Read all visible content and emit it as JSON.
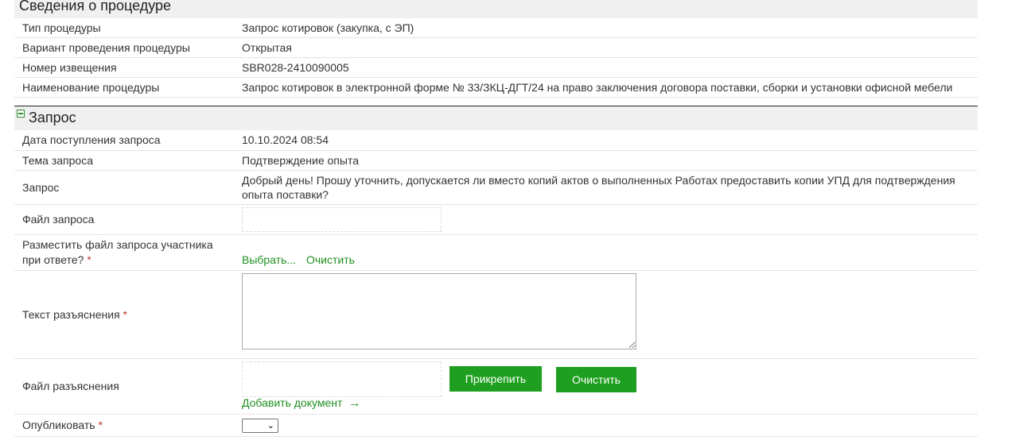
{
  "procedure": {
    "section_title": "Сведения о процедуре",
    "rows": [
      {
        "label": "Тип процедуры",
        "value": "Запрос котировок (закупка, с ЭП)"
      },
      {
        "label": "Вариант проведения процедуры",
        "value": "Открытая"
      },
      {
        "label": "Номер извещения",
        "value": "SBR028-2410090005"
      },
      {
        "label": "Наименование процедуры",
        "value": "Запрос котировок в электронной форме № 33/ЗКЦ-ДГТ/24 на право заключения договора поставки, сборки и установки офисной мебели"
      }
    ]
  },
  "request": {
    "section_title": "Запрос",
    "date_label": "Дата поступления запроса",
    "date_value": "10.10.2024 08:54",
    "topic_label": "Тема запроса",
    "topic_value": "Подтверждение опыта",
    "request_label": "Запрос",
    "request_value_line1": "Добрый день! Прошу уточнить, допускается ли вместо копий актов о выполненных Работах предоставить копии УПД для подтверждения",
    "request_value_line2": "опыта поставки?",
    "file_label": "Файл запроса",
    "place_file_label_line1": "Разместить файл запроса участника",
    "place_file_label_line2": "при ответе?",
    "required_mark": "*",
    "choose_link": "Выбрать...",
    "clear_link": "Очистить",
    "explanation_text_label": "Текст разъяснения",
    "explanation_text_value": "",
    "explanation_file_label": "Файл разъяснения",
    "attach_button": "Прикрепить",
    "clear_button": "Очистить",
    "add_document_link": "Добавить документ",
    "publish_label": "Опубликовать",
    "publish_value": ""
  },
  "colors": {
    "accent_green": "#1f9f1f",
    "link_green": "#1f8f1f",
    "required_red": "#c0392b",
    "section_bg": "#f0f0f0"
  }
}
